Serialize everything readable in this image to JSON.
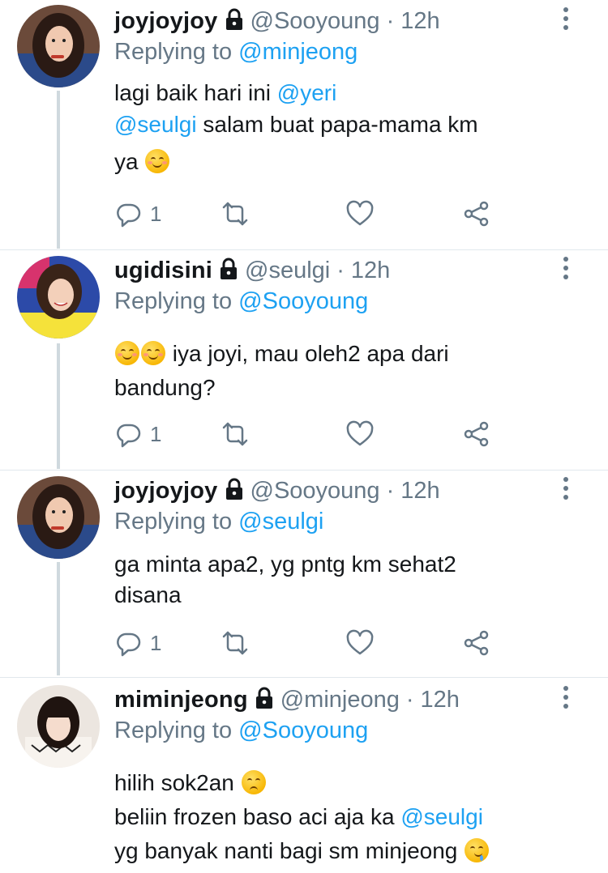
{
  "colors": {
    "accent": "#1da1f2",
    "muted": "#657786",
    "text": "#14171a",
    "divider": "#e1e8ed"
  },
  "tweets": [
    {
      "name": "joyjoyjoy",
      "handle": "@Sooyoung",
      "dot": "·",
      "time": "12h",
      "reply_prefix": "Replying to",
      "reply_to": "@minjeong",
      "lines": [
        {
          "pre": "lagi baik hari ini ",
          "mention": "@yeri",
          "post": ""
        },
        {
          "pre": "",
          "mention": "@seulgi",
          "post": " salam buat papa-mama km"
        },
        {
          "pre": "ya ",
          "mention": "",
          "post": "",
          "emoji": "smiling-face-with-smiling-eyes"
        }
      ],
      "reply_count": "1",
      "avatar": "avatar-joyjoyjoy"
    },
    {
      "name": "ugidisini",
      "handle": "@seulgi",
      "dot": "·",
      "time": "12h",
      "reply_prefix": "Replying to",
      "reply_to": "@Sooyoung",
      "lines": [
        {
          "pre": " iya joyi, mau oleh2 apa dari",
          "lead_emoji": "smiling-face-with-smiling-eyes"
        },
        {
          "pre": "bandung?"
        }
      ],
      "reply_count": "1",
      "avatar": "avatar-ugidisini"
    },
    {
      "name": "joyjoyjoy",
      "handle": "@Sooyoung",
      "dot": "·",
      "time": "12h",
      "reply_prefix": "Replying to",
      "reply_to": "@seulgi",
      "lines": [
        {
          "pre": "ga minta apa2, yg pntg km sehat2"
        },
        {
          "pre": "disana"
        }
      ],
      "reply_count": "1",
      "avatar": "avatar-joyjoyjoy"
    },
    {
      "name": "miminjeong",
      "handle": "@minjeong",
      "dot": "·",
      "time": "12h",
      "reply_prefix": "Replying to",
      "reply_to": "@Sooyoung",
      "lines": [
        {
          "pre": "hilih sok2an ",
          "emoji": "unamused-face"
        },
        {
          "pre": "beliin frozen baso aci aja ka ",
          "mention": "@seulgi"
        },
        {
          "pre": "yg banyak nanti bagi sm minjeong ",
          "emoji": "drooling-face"
        }
      ],
      "avatar": "avatar-miminjeong"
    }
  ]
}
